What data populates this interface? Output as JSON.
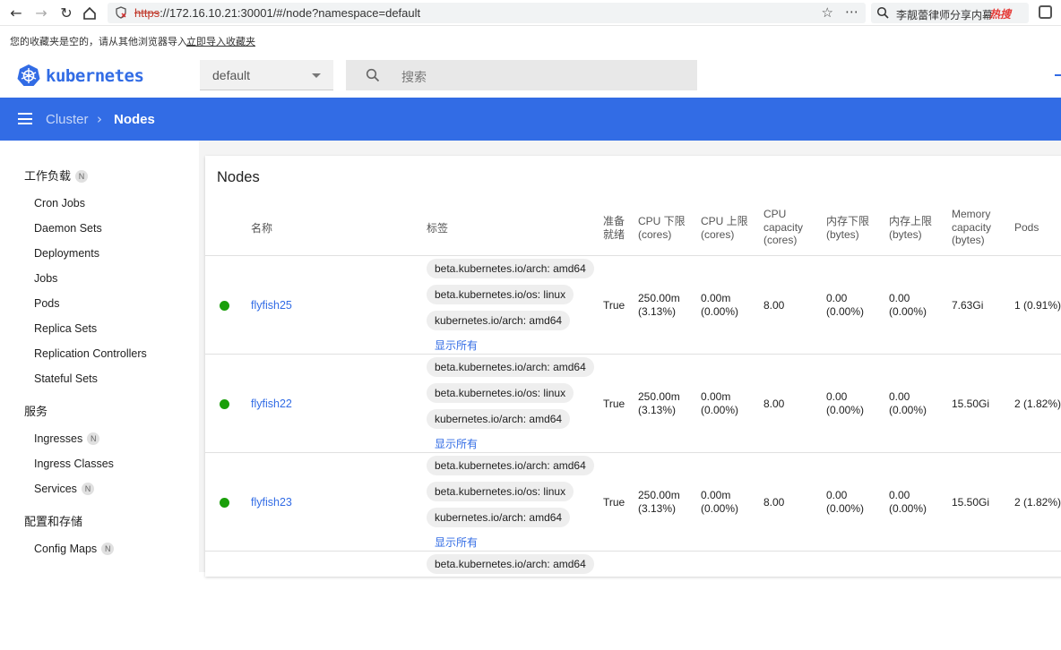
{
  "browser": {
    "url_scheme": "https",
    "url_rest": "://172.16.10.21:30001/#/node?namespace=default",
    "hot_search_text": "李靓蕾律师分享内幕",
    "hot_badge": "热搜",
    "bookmark_notice": "您的收藏夹是空的，请从其他浏览器导入。",
    "bookmark_import_link": "立即导入收藏夹"
  },
  "header": {
    "brand": "kubernetes",
    "namespace": "default",
    "search_placeholder": "搜索",
    "brand_color": "#326ce5"
  },
  "breadcrumb": {
    "parent": "Cluster",
    "separator": "›",
    "current": "Nodes"
  },
  "sidebar": {
    "workloads": "工作负载",
    "workloads_badge": "N",
    "items_workloads": [
      "Cron Jobs",
      "Daemon Sets",
      "Deployments",
      "Jobs",
      "Pods",
      "Replica Sets",
      "Replication Controllers",
      "Stateful Sets"
    ],
    "services": "服务",
    "ingresses": "Ingresses",
    "ingresses_badge": "N",
    "ingress_classes": "Ingress Classes",
    "services_item": "Services",
    "services_badge": "N",
    "config_storage": "配置和存储",
    "config_maps": "Config Maps",
    "config_maps_badge": "N"
  },
  "card": {
    "title": "Nodes",
    "columns": {
      "name": "名称",
      "labels": "标签",
      "ready_1": "准备",
      "ready_2": "就绪",
      "cpu_req_1": "CPU 下限",
      "cpu_req_2": "(cores)",
      "cpu_lim_1": "CPU 上限",
      "cpu_lim_2": "(cores)",
      "cpu_cap_1": "CPU",
      "cpu_cap_2": "capacity",
      "cpu_cap_3": "(cores)",
      "mem_req_1": "内存下限",
      "mem_req_2": "(bytes)",
      "mem_lim_1": "内存上限",
      "mem_lim_2": "(bytes)",
      "mem_cap_1": "Memory",
      "mem_cap_2": "capacity",
      "mem_cap_3": "(bytes)",
      "pods": "Pods"
    },
    "show_all": "显示所有",
    "rows": [
      {
        "name": "flyfish25",
        "labels": [
          "beta.kubernetes.io/arch: amd64",
          "beta.kubernetes.io/os: linux",
          "kubernetes.io/arch: amd64"
        ],
        "ready": "True",
        "cpu_req": "250.00m",
        "cpu_req_pct": "(3.13%)",
        "cpu_lim": "0.00m",
        "cpu_lim_pct": "(0.00%)",
        "cpu_cap": "8.00",
        "mem_req": "0.00",
        "mem_req_pct": "(0.00%)",
        "mem_lim": "0.00",
        "mem_lim_pct": "(0.00%)",
        "mem_cap": "7.63Gi",
        "pods": "1 (0.91%)"
      },
      {
        "name": "flyfish22",
        "labels": [
          "beta.kubernetes.io/arch: amd64",
          "beta.kubernetes.io/os: linux",
          "kubernetes.io/arch: amd64"
        ],
        "ready": "True",
        "cpu_req": "250.00m",
        "cpu_req_pct": "(3.13%)",
        "cpu_lim": "0.00m",
        "cpu_lim_pct": "(0.00%)",
        "cpu_cap": "8.00",
        "mem_req": "0.00",
        "mem_req_pct": "(0.00%)",
        "mem_lim": "0.00",
        "mem_lim_pct": "(0.00%)",
        "mem_cap": "15.50Gi",
        "pods": "2 (1.82%)"
      },
      {
        "name": "flyfish23",
        "labels": [
          "beta.kubernetes.io/arch: amd64",
          "beta.kubernetes.io/os: linux",
          "kubernetes.io/arch: amd64"
        ],
        "ready": "True",
        "cpu_req": "250.00m",
        "cpu_req_pct": "(3.13%)",
        "cpu_lim": "0.00m",
        "cpu_lim_pct": "(0.00%)",
        "cpu_cap": "8.00",
        "mem_req": "0.00",
        "mem_req_pct": "(0.00%)",
        "mem_lim": "0.00",
        "mem_lim_pct": "(0.00%)",
        "mem_cap": "15.50Gi",
        "pods": "2 (1.82%)"
      },
      {
        "labels": [
          "beta.kubernetes.io/arch: amd64"
        ]
      }
    ],
    "status_color": "#1a9f0a"
  }
}
